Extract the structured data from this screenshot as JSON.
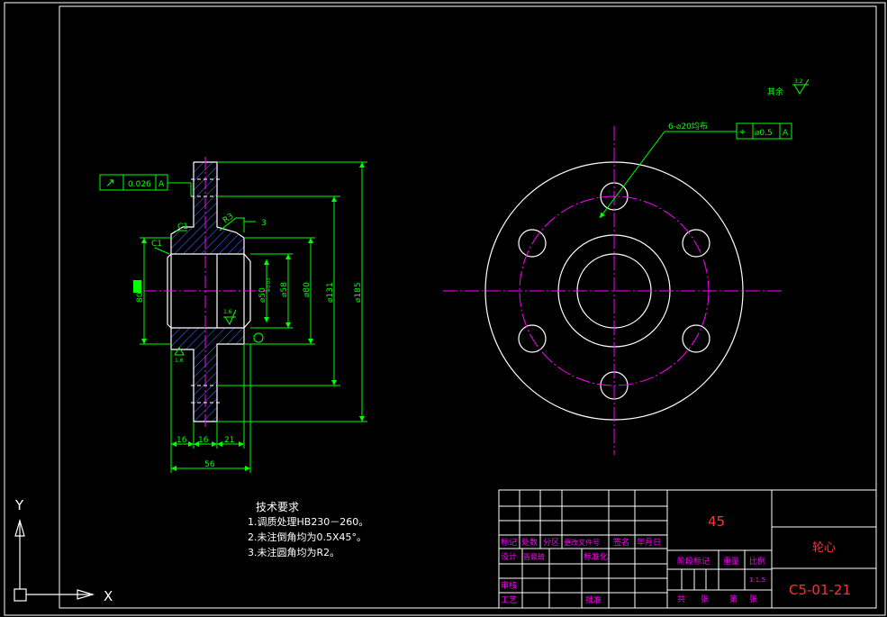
{
  "colors": {
    "background": "#000000",
    "border": "#ffffff",
    "dimension": "#00ff00",
    "centerline": "#ff00ff",
    "hatch": "#4a5cff",
    "title_red": "#ff3030",
    "title_block_text": "#ff00ff"
  },
  "surface_note": {
    "label": "其余",
    "value": "3.2"
  },
  "hole_note": "6-⌀20均布",
  "position_frame": {
    "symbol": "⌖",
    "tolerance": "⌀0.5",
    "datum": "A"
  },
  "runout_frame": {
    "symbol": "↗",
    "tolerance": "0.026",
    "datum": "A"
  },
  "dimensions": {
    "d185": "⌀185",
    "d131": "⌀131",
    "d80": "⌀80",
    "d58": "⌀58",
    "d50": "⌀50",
    "d50_tol": "+0.03",
    "len80": "80",
    "r3": "R3",
    "three": "3",
    "c1_top": "C1",
    "c1_bore": "C1",
    "w16a": "16",
    "w16b": "16",
    "w21": "21",
    "w56": "56",
    "rough1": "1.6",
    "rough2": "1.6"
  },
  "tech": {
    "title": "技术要求",
    "items": [
      "1.调质处理HB230－260。",
      "2.未注倒角均为0.5X45°。",
      "3.未注圆角均为R2。"
    ]
  },
  "title_block": {
    "material": "45",
    "part_name": "轮心",
    "drawing_no": "C5-01-21",
    "scale": "1:1.5",
    "labels": {
      "mark": "标记",
      "count": "处数",
      "zone": "分区",
      "doc": "更改文件号",
      "sign": "签名",
      "date": "年月日",
      "design": "设计",
      "review": "审核",
      "process": "工艺",
      "standard": "标准化",
      "approve": "批准",
      "stage": "阶段标记",
      "weight": "重量",
      "ratio": "比例",
      "total": "共",
      "sheets": "张",
      "sheet_no": "第",
      "sheet_unit": "张"
    },
    "signature": "晋晨琦"
  },
  "ucs": {
    "x": "X",
    "y": "Y"
  }
}
